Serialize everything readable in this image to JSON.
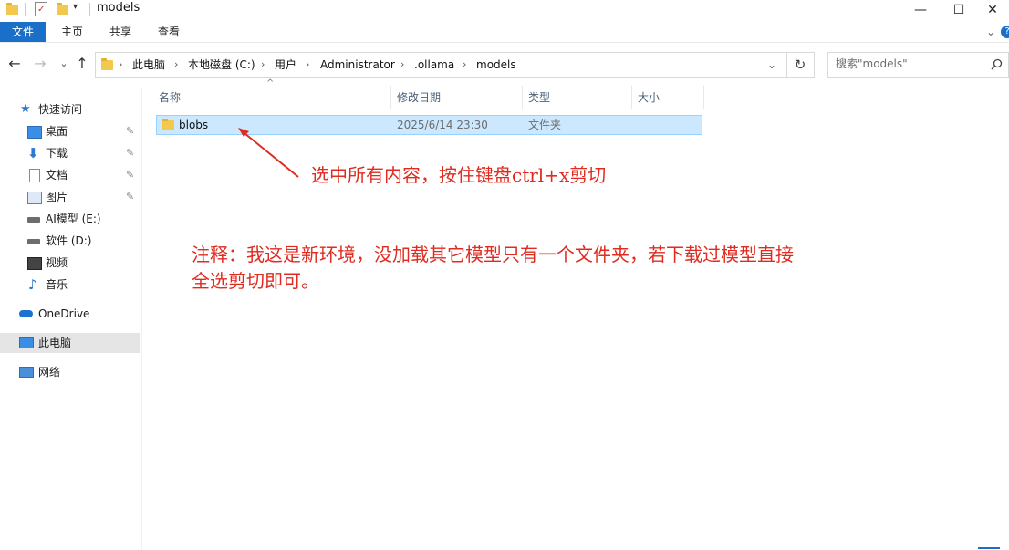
{
  "window": {
    "title": "models",
    "minimize_glyph": "—",
    "maximize_glyph": "☐",
    "close_glyph": "✕"
  },
  "ribbon": {
    "tabs": [
      "文件",
      "主页",
      "共享",
      "查看"
    ],
    "expand_glyph": "⌄",
    "help_glyph": "?"
  },
  "address": {
    "crumbs": [
      "此电脑",
      "本地磁盘 (C:)",
      "用户",
      "Administrator",
      ".ollama",
      "models"
    ],
    "separator": "›",
    "dropdown_glyph": "⌄",
    "refresh_glyph": "↻"
  },
  "nav_buttons": {
    "back": "←",
    "forward": "→",
    "recent": "⌄",
    "up": "↑"
  },
  "search": {
    "placeholder": "搜索\"models\"",
    "icon": "search-icon"
  },
  "sidebar": {
    "quick_access": "快速访问",
    "items": [
      {
        "label": "桌面",
        "icon": "desktop-icon",
        "pinned": true
      },
      {
        "label": "下载",
        "icon": "download-icon",
        "pinned": true
      },
      {
        "label": "文档",
        "icon": "document-icon",
        "pinned": true
      },
      {
        "label": "图片",
        "icon": "picture-icon",
        "pinned": true
      },
      {
        "label": "AI模型 (E:)",
        "icon": "drive-icon",
        "pinned": false
      },
      {
        "label": "软件 (D:)",
        "icon": "drive-icon",
        "pinned": false
      },
      {
        "label": "视频",
        "icon": "video-icon",
        "pinned": false
      },
      {
        "label": "音乐",
        "icon": "music-icon",
        "pinned": false
      }
    ],
    "onedrive": "OneDrive",
    "this_pc": "此电脑",
    "network": "网络",
    "pin_glyph": "📌"
  },
  "file_list": {
    "columns": [
      "名称",
      "修改日期",
      "类型",
      "大小"
    ],
    "sort_glyph": "^",
    "rows": [
      {
        "name": "blobs",
        "modified": "2025/6/14 23:30",
        "type": "文件夹",
        "size": "",
        "selected": true
      }
    ]
  },
  "annotations": {
    "arrow_note": "选中所有内容，按住键盘ctrl+x剪切",
    "note_line1": "注释：我这是新环境，没加载其它模型只有一个文件夹，若下载过模型直接",
    "note_line2": "全选剪切即可。",
    "color": "#e02b20"
  },
  "colors": {
    "accent": "#1a6fc9",
    "selection_fill": "#cce8ff",
    "selection_border": "#99d1ff",
    "folder": "#f2c94c"
  }
}
